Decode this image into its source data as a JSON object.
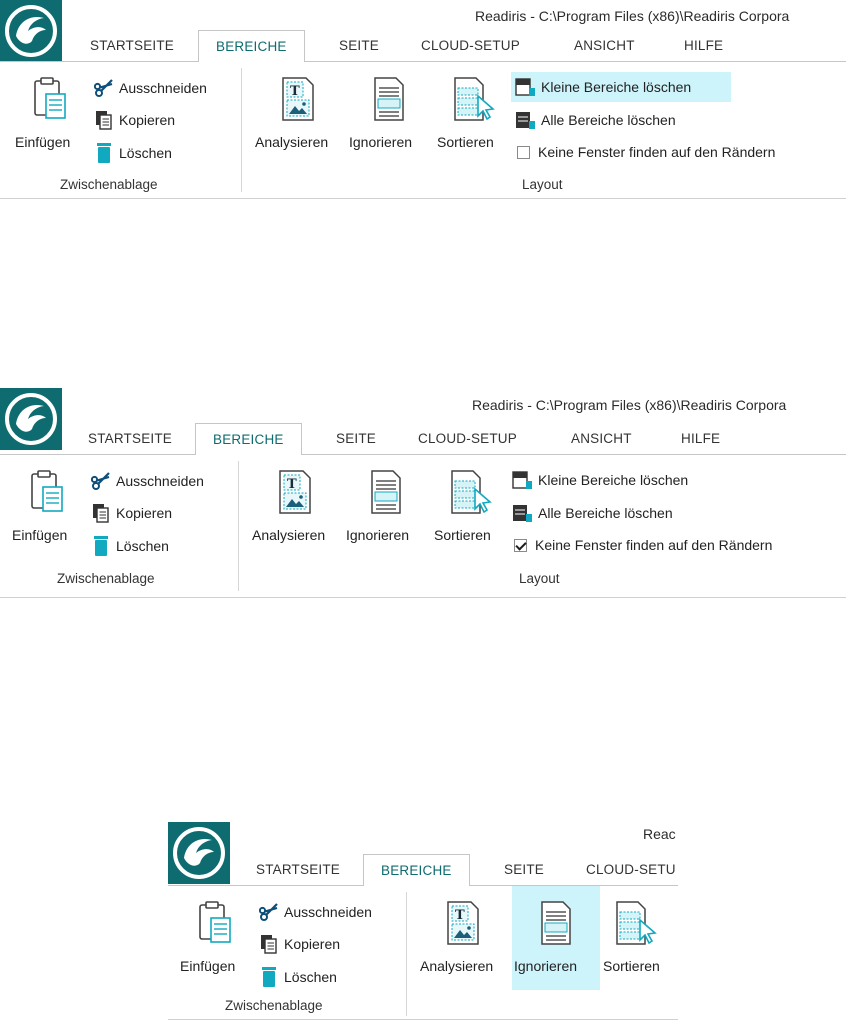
{
  "screens": [
    {
      "title": "Readiris - C:\\Program Files (x86)\\Readiris Corpora",
      "tabs": [
        "STARTSEITE",
        "BEREICHE",
        "SEITE",
        "CLOUD-SETUP",
        "ANSICHT",
        "HILFE"
      ],
      "active_tab": "BEREICHE",
      "clipboard": {
        "paste": "Einfügen",
        "cut": "Ausschneiden",
        "copy": "Kopieren",
        "delete": "Löschen",
        "group": "Zwischenablage"
      },
      "layout": {
        "analyze": "Analysieren",
        "ignore": "Ignorieren",
        "sort": "Sortieren",
        "small_zones": "Kleine Bereiche löschen",
        "all_zones": "Alle Bereiche löschen",
        "no_border": "Keine Fenster finden auf den Rändern",
        "no_border_checked": false,
        "highlight": "small_zones",
        "group": "Layout"
      }
    },
    {
      "title": "Readiris - C:\\Program Files (x86)\\Readiris Corpora",
      "tabs": [
        "STARTSEITE",
        "BEREICHE",
        "SEITE",
        "CLOUD-SETUP",
        "ANSICHT",
        "HILFE"
      ],
      "active_tab": "BEREICHE",
      "clipboard": {
        "paste": "Einfügen",
        "cut": "Ausschneiden",
        "copy": "Kopieren",
        "delete": "Löschen",
        "group": "Zwischenablage"
      },
      "layout": {
        "analyze": "Analysieren",
        "ignore": "Ignorieren",
        "sort": "Sortieren",
        "small_zones": "Kleine Bereiche löschen",
        "all_zones": "Alle Bereiche löschen",
        "no_border": "Keine Fenster finden auf den Rändern",
        "no_border_checked": true,
        "highlight": "",
        "group": "Layout"
      }
    },
    {
      "title": "Reac",
      "tabs": [
        "STARTSEITE",
        "BEREICHE",
        "SEITE",
        "CLOUD-SETU"
      ],
      "active_tab": "BEREICHE",
      "clipboard": {
        "paste": "Einfügen",
        "cut": "Ausschneiden",
        "copy": "Kopieren",
        "delete": "Löschen",
        "group": "Zwischenablage"
      },
      "layout": {
        "analyze": "Analysieren",
        "ignore": "Ignorieren",
        "sort": "Sortieren",
        "highlight": "ignore"
      }
    }
  ],
  "colors": {
    "brand": "#0e6b6f",
    "accent": "#11a9c0",
    "highlight": "#cdf3fb"
  },
  "icons": [
    "readiris-logo-icon",
    "clipboard-paste-icon",
    "scissors-icon",
    "copy-icon",
    "trash-icon",
    "analyze-zone-icon",
    "ignore-document-icon",
    "sort-zones-icon",
    "delete-small-zones-icon",
    "delete-all-zones-icon",
    "checkbox-icon"
  ]
}
